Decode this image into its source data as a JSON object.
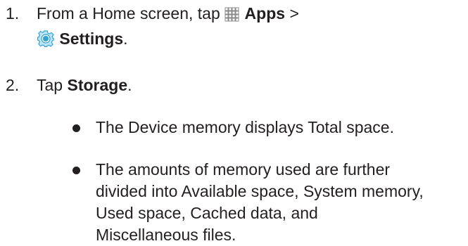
{
  "steps": [
    {
      "number": "1.",
      "line1": {
        "prefix": "From a Home screen, tap",
        "apps_icon": "apps-grid-icon",
        "apps_label": "Apps",
        "separator": ">"
      },
      "line2": {
        "settings_icon": "settings-gear-icon",
        "settings_label": "Settings",
        "suffix": "."
      }
    },
    {
      "number": "2.",
      "prefix": "Tap",
      "bold": "Storage",
      "suffix": "."
    }
  ],
  "bullets": [
    {
      "lines": [
        "The Device memory displays Total space."
      ]
    },
    {
      "lines": [
        "The amounts of memory used are further",
        "divided into Available space, System memory,",
        "Used space, Cached data, and",
        "Miscellaneous files."
      ]
    }
  ],
  "colors": {
    "text": "#231f20",
    "icon_accent": "#2fa3d8",
    "icon_outline": "#8a8a8a"
  }
}
